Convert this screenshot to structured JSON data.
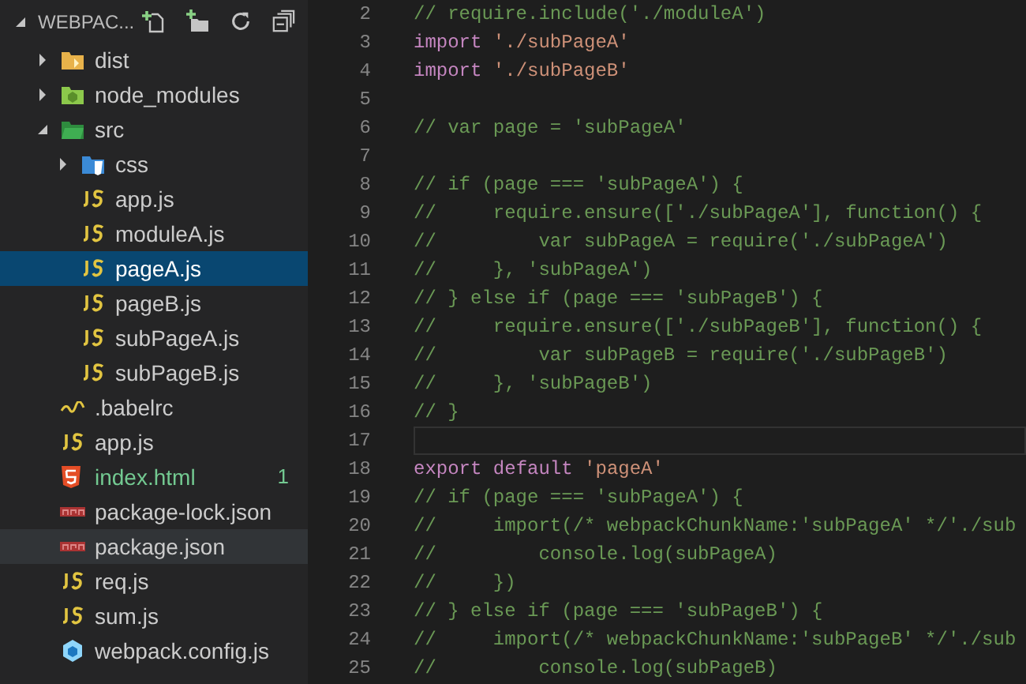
{
  "explorer": {
    "title": "WEBPAC...",
    "expanded": true,
    "tree": [
      {
        "name": "dist",
        "kind": "folder_dist",
        "expanded": false,
        "selected": false
      },
      {
        "name": "node_modules",
        "kind": "folder_node",
        "expanded": false,
        "selected": false
      },
      {
        "name": "src",
        "kind": "folder_src",
        "expanded": true,
        "selected": false,
        "children": [
          {
            "name": "css",
            "kind": "folder_css",
            "expanded": false,
            "selected": false
          },
          {
            "name": "app.js",
            "kind": "js",
            "selected": false
          },
          {
            "name": "moduleA.js",
            "kind": "js",
            "selected": false
          },
          {
            "name": "pageA.js",
            "kind": "js",
            "selected": true
          },
          {
            "name": "pageB.js",
            "kind": "js",
            "selected": false
          },
          {
            "name": "subPageA.js",
            "kind": "js",
            "selected": false
          },
          {
            "name": "subPageB.js",
            "kind": "js",
            "selected": false
          }
        ]
      },
      {
        "name": ".babelrc",
        "kind": "babel",
        "selected": false
      },
      {
        "name": "app.js",
        "kind": "js",
        "selected": false
      },
      {
        "name": "index.html",
        "kind": "html",
        "selected": false,
        "color": "#73c991",
        "badge": "1"
      },
      {
        "name": "package-lock.json",
        "kind": "npm",
        "selected": false
      },
      {
        "name": "package.json",
        "kind": "npm",
        "selected": false,
        "hovered": true
      },
      {
        "name": "req.js",
        "kind": "js",
        "selected": false
      },
      {
        "name": "sum.js",
        "kind": "js",
        "selected": false
      },
      {
        "name": "webpack.config.js",
        "kind": "webpack",
        "selected": false
      }
    ]
  },
  "editor": {
    "lines": [
      {
        "number": "2",
        "tokens": [
          {
            "kind": "comment",
            "text": "// require.include('./moduleA')"
          }
        ]
      },
      {
        "number": "3",
        "tokens": [
          {
            "kind": "keyword",
            "text": "import"
          },
          {
            "kind": "string",
            "text": "'./subPageA'"
          }
        ]
      },
      {
        "number": "4",
        "tokens": [
          {
            "kind": "keyword",
            "text": "import"
          },
          {
            "kind": "string",
            "text": "'./subPageB'"
          }
        ]
      },
      {
        "number": "5"
      },
      {
        "number": "6",
        "tokens": [
          {
            "kind": "comment",
            "text": "// var page = 'subPageA'"
          }
        ]
      },
      {
        "number": "7"
      },
      {
        "number": "8",
        "tokens": [
          {
            "kind": "comment",
            "text": "// if (page === 'subPageA') {"
          }
        ]
      },
      {
        "number": "9",
        "tokens": [
          {
            "kind": "comment",
            "text": "//     require.ensure(['./subPageA'], function() {"
          }
        ]
      },
      {
        "number": "10",
        "tokens": [
          {
            "kind": "comment",
            "text": "//         var subPageA = require('./subPageA')"
          }
        ]
      },
      {
        "number": "11",
        "tokens": [
          {
            "kind": "comment",
            "text": "//     }, 'subPageA')"
          }
        ]
      },
      {
        "number": "12",
        "tokens": [
          {
            "kind": "comment",
            "text": "// } else if (page === 'subPageB') {"
          }
        ]
      },
      {
        "number": "13",
        "tokens": [
          {
            "kind": "comment",
            "text": "//     require.ensure(['./subPageB'], function() {"
          }
        ]
      },
      {
        "number": "14",
        "tokens": [
          {
            "kind": "comment",
            "text": "//         var subPageB = require('./subPageB')"
          }
        ]
      },
      {
        "number": "15",
        "tokens": [
          {
            "kind": "comment",
            "text": "//     }, 'subPageB')"
          }
        ]
      },
      {
        "number": "16",
        "tokens": [
          {
            "kind": "comment",
            "text": "// }"
          }
        ]
      },
      {
        "number": "17",
        "current": true
      },
      {
        "number": "18",
        "tokens": [
          {
            "kind": "keyword",
            "text": "export"
          },
          {
            "kind": "keyword",
            "text": "default"
          },
          {
            "kind": "string",
            "text": "'pageA'"
          }
        ]
      },
      {
        "number": "19",
        "tokens": [
          {
            "kind": "comment",
            "text": "// if (page === 'subPageA') {"
          }
        ]
      },
      {
        "number": "20",
        "tokens": [
          {
            "kind": "comment",
            "text": "//     import(/* webpackChunkName:'subPageA' */'./sub"
          }
        ]
      },
      {
        "number": "21",
        "tokens": [
          {
            "kind": "comment",
            "text": "//         console.log(subPageA)"
          }
        ]
      },
      {
        "number": "22",
        "tokens": [
          {
            "kind": "comment",
            "text": "//     })"
          }
        ]
      },
      {
        "number": "23",
        "tokens": [
          {
            "kind": "comment",
            "text": "// } else if (page === 'subPageB') {"
          }
        ]
      },
      {
        "number": "24",
        "tokens": [
          {
            "kind": "comment",
            "text": "//     import(/* webpackChunkName:'subPageB' */'./sub"
          }
        ]
      },
      {
        "number": "25",
        "tokens": [
          {
            "kind": "comment",
            "text": "//         console.log(subPageB)"
          }
        ]
      }
    ]
  }
}
